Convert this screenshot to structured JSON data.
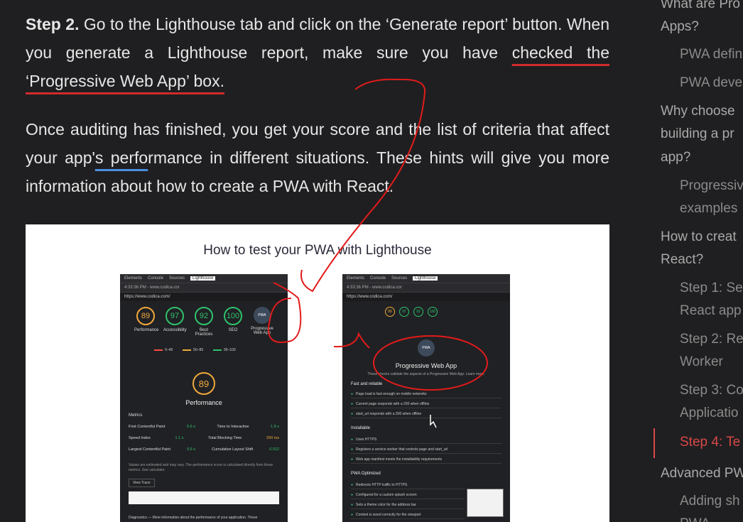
{
  "article": {
    "step2_bold": "Step 2.",
    "step2_text": " Go to the Lighthouse tab and click on the ‘Generate report’ button. When you generate a Lighthouse report, make sure you have ",
    "step2_underlined": "checked the ‘Progressive Web App’ box.",
    "para2_start": "Once auditing has finished, you get your score and the list of criteria that affect your app'",
    "para2_underlined": "s perfo",
    "para2_end": "rmance in different situations. These hints will give you more information about how to create a PWA with React."
  },
  "figure": {
    "title": "How to test your PWA with Lighthouse",
    "devtools_tabs": [
      "Elements",
      "Console",
      "Sources",
      "Lighthouse"
    ],
    "url_time": "4:33:36 PM - www.codica.cor",
    "site_url": "https://www.codica.com/",
    "gauges": [
      {
        "score": "89",
        "label": "Performance",
        "color": "orange"
      },
      {
        "score": "97",
        "label": "Accessibility",
        "color": "green"
      },
      {
        "score": "92",
        "label": "Best Practices",
        "color": "green"
      },
      {
        "score": "100",
        "label": "SEO",
        "color": "green"
      }
    ],
    "pwa_badge": "PWA",
    "pwa_label": "Progressive Web App",
    "legend": [
      "0–49",
      "50–89",
      "90–100"
    ],
    "big_score": "89",
    "perf_label": "Performance",
    "metrics_title": "Metrics",
    "metrics": [
      [
        "First Contentful Paint",
        "0.6 s",
        "Time to Interactive",
        "1.8 s"
      ],
      [
        "Speed Index",
        "1.1 s",
        "Total Blocking Time",
        "200 ms"
      ],
      [
        "Largest Contentful Paint",
        "0.6 s",
        "Cumulative Layout Shift",
        "0.012"
      ]
    ],
    "disclaimer": "Values are estimated and may vary. The performance score is calculated directly from these metrics. See calculator.",
    "view_trace": "View Trace",
    "diagnostics": "Diagnostics — More information about the performance of your application. These",
    "pwa_title": "Progressive Web App",
    "pwa_desc": "These checks validate the aspects of a Progressive Web App. Learn more.",
    "fast_reliable": "Fast and reliable",
    "checks_fast": [
      "Page load is fast enough on mobile networks",
      "Current page responds with a 200 when offline",
      "start_url responds with a 200 when offline"
    ],
    "installable": "Installable",
    "checks_install": [
      "Uses HTTPS",
      "Registers a service worker that controls page and start_url",
      "Web app manifest meets the installability requirements"
    ],
    "pwa_optimized": "PWA Optimized",
    "checks_opt": [
      "Redirects HTTP traffic to HTTPS",
      "Configured for a custom splash screen",
      "Sets a theme color for the address bar",
      "Content is sized correctly for the viewport"
    ]
  },
  "toc": {
    "items": [
      {
        "text": "What are Pro",
        "sub": false
      },
      {
        "text": "Apps?",
        "sub": false
      },
      {
        "text": "PWA defin",
        "sub": true
      },
      {
        "text": "PWA deve",
        "sub": true
      },
      {
        "text": "Why choose",
        "sub": false
      },
      {
        "text": "building a pr",
        "sub": false
      },
      {
        "text": "app?",
        "sub": false
      },
      {
        "text": "Progressiv",
        "sub": true
      },
      {
        "text": "examples",
        "sub": true
      },
      {
        "text": "How to creat",
        "sub": false
      },
      {
        "text": "React?",
        "sub": false
      },
      {
        "text": "Step 1: Set",
        "sub": true
      },
      {
        "text": "React app",
        "sub": true
      },
      {
        "text": "Step 2: Re",
        "sub": true
      },
      {
        "text": "Worker",
        "sub": true
      },
      {
        "text": "Step 3: Co",
        "sub": true
      },
      {
        "text": "Applicatio",
        "sub": true
      },
      {
        "text": "Step 4: Te",
        "sub": true,
        "active": true
      },
      {
        "text": "Advanced PW",
        "sub": false
      },
      {
        "text": "Adding sh",
        "sub": true
      },
      {
        "text": "PWA",
        "sub": true
      }
    ]
  },
  "colors": {
    "background": "#1f1f21",
    "accent_red": "#d94848",
    "link_blue": "#4a90e2"
  }
}
